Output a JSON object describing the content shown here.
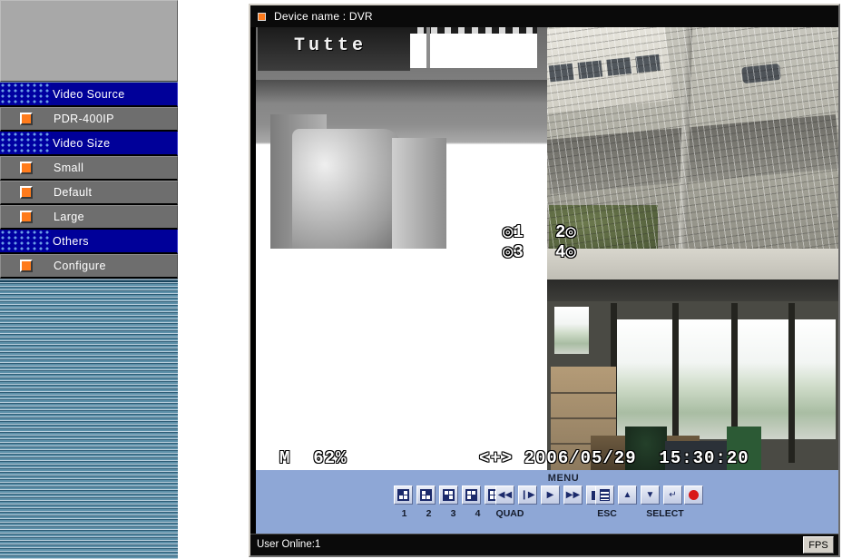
{
  "colors": {
    "menu_header_bg": "#000099",
    "menu_item_bg": "#6e6e6e",
    "bullet_orange": "#ff7b1c",
    "controlbar_blue": "#8ea7d6",
    "record_red": "#d81818",
    "sidebar_fill_teal": "#4a7d96"
  },
  "sidebar": {
    "items": [
      {
        "label": "Video Source",
        "type": "header",
        "icon": "dotted-pattern-icon",
        "selected": true
      },
      {
        "label": "PDR-400IP",
        "type": "item",
        "icon": "orange-bullet-icon",
        "selected": false
      },
      {
        "label": "Video Size",
        "type": "header",
        "icon": "dotted-pattern-icon",
        "selected": true
      },
      {
        "label": "Small",
        "type": "item",
        "icon": "orange-bullet-icon",
        "selected": false
      },
      {
        "label": "Default",
        "type": "item",
        "icon": "orange-bullet-icon",
        "selected": false
      },
      {
        "label": "Large",
        "type": "item",
        "icon": "orange-bullet-icon",
        "selected": false
      },
      {
        "label": "Others",
        "type": "header",
        "icon": "dotted-pattern-icon",
        "selected": true
      },
      {
        "label": "Configure",
        "type": "item",
        "icon": "orange-bullet-icon",
        "selected": false
      }
    ]
  },
  "dvr": {
    "titlebar": {
      "bullet_icon": "orange-square-icon",
      "title": "Device name : DVR"
    },
    "video": {
      "layout": "quad",
      "channels": [
        {
          "id": 1,
          "osd": "◎1",
          "scene": "greyscale-monitor-on-desk",
          "monitor_text": "Tutte"
        },
        {
          "id": 2,
          "osd": "2◎",
          "scene": "outdoor-street-behind-fence"
        },
        {
          "id": 3,
          "osd": "◎3",
          "scene": "blank-white"
        },
        {
          "id": 4,
          "osd": "4◎",
          "scene": "office-interior-windows"
        }
      ],
      "osd_bottom_left": "M  62%",
      "osd_bottom_right": "<+> 2006/05/29  15:30:20"
    },
    "controlbar": {
      "menu_caption": "MENU",
      "camera_buttons": [
        {
          "name": "camera-1-button",
          "label": "1",
          "icon": "quad-cell-1-icon",
          "active_cell": 0
        },
        {
          "name": "camera-2-button",
          "label": "2",
          "icon": "quad-cell-2-icon",
          "active_cell": 1
        },
        {
          "name": "camera-3-button",
          "label": "3",
          "icon": "quad-cell-3-icon",
          "active_cell": 2
        },
        {
          "name": "camera-4-button",
          "label": "4",
          "icon": "quad-cell-4-icon",
          "active_cell": 3
        },
        {
          "name": "quad-button",
          "label": "QUAD",
          "icon": "quad-grid-icon",
          "active_cell": -1
        }
      ],
      "playback_buttons": [
        {
          "name": "rewind-button",
          "icon": "rewind-icon",
          "glyph": "◀◀"
        },
        {
          "name": "step-frame-button",
          "icon": "step-frame-icon",
          "glyph": "❙▶"
        },
        {
          "name": "play-button",
          "icon": "play-icon",
          "glyph": "▶"
        },
        {
          "name": "fast-forward-button",
          "icon": "fast-forward-icon",
          "glyph": "▶▶"
        },
        {
          "name": "stop-button",
          "icon": "stop-icon",
          "glyph": "■"
        }
      ],
      "nav_buttons": [
        {
          "name": "menu-button",
          "icon": "list-menu-icon"
        },
        {
          "name": "up-button",
          "icon": "triangle-up-icon",
          "glyph": "▲"
        },
        {
          "name": "down-button",
          "icon": "triangle-down-icon",
          "glyph": "▼"
        },
        {
          "name": "enter-button",
          "icon": "enter-arrow-icon",
          "glyph": "↵"
        }
      ],
      "record_button": {
        "name": "record-button",
        "icon": "record-dot-icon"
      },
      "esc_label": "ESC",
      "select_label": "SELECT"
    },
    "statusbar": {
      "user_online": "User Online:1",
      "fps_label": "FPS"
    }
  }
}
